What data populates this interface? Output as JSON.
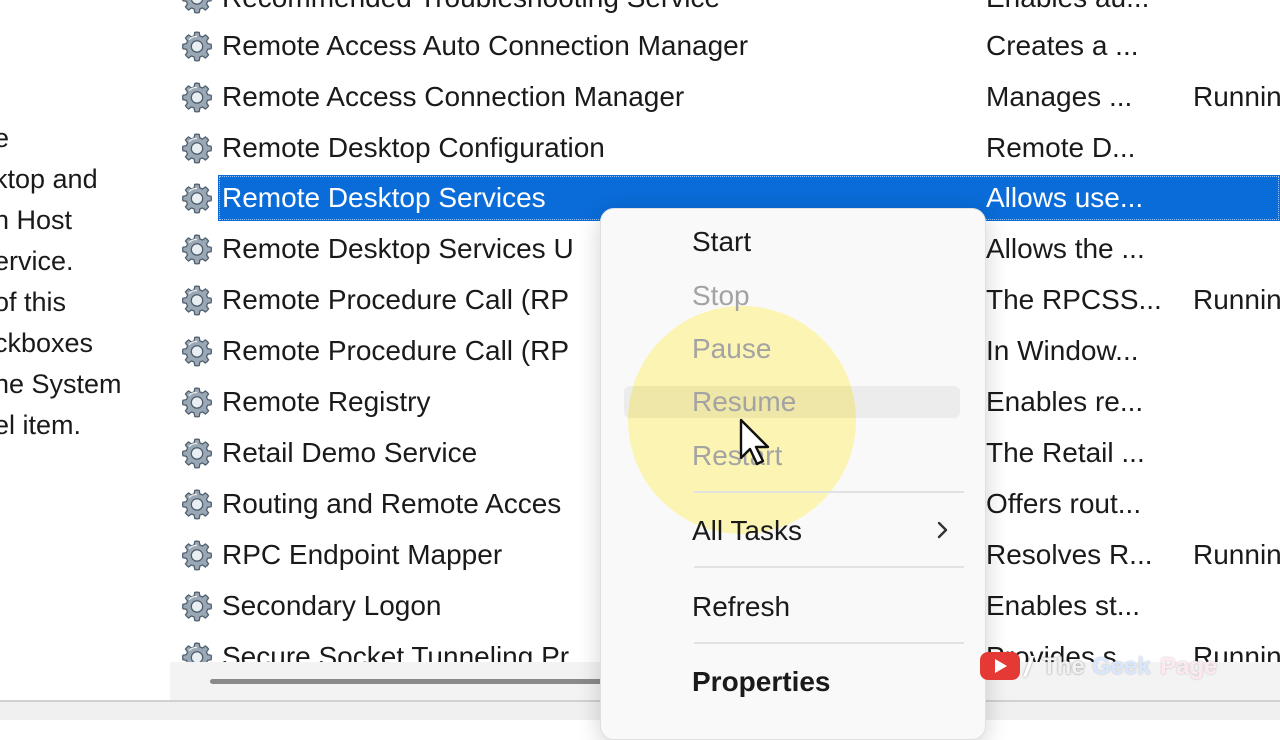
{
  "description_pane": {
    "lines": [
      "e",
      "ktop and",
      "n Host",
      "ervice.",
      "of this",
      "ckboxes",
      "ne System",
      "el item."
    ]
  },
  "services": [
    {
      "name": "Recommended Troubleshooting Service",
      "description": "Enables au...",
      "status": ""
    },
    {
      "name": "Remote Access Auto Connection Manager",
      "description": "Creates a ...",
      "status": ""
    },
    {
      "name": "Remote Access Connection Manager",
      "description": "Manages ...",
      "status": "Runnin"
    },
    {
      "name": "Remote Desktop Configuration",
      "description": "Remote D...",
      "status": ""
    },
    {
      "name": "Remote Desktop Services",
      "description": "Allows use...",
      "status": "",
      "selected": true
    },
    {
      "name": "Remote Desktop Services U",
      "description": "Allows the ...",
      "status": ""
    },
    {
      "name": "Remote Procedure Call (RP",
      "description": "The RPCSS...",
      "status": "Runnin"
    },
    {
      "name": "Remote Procedure Call (RP",
      "description": "In Window...",
      "status": ""
    },
    {
      "name": "Remote Registry",
      "description": "Enables re...",
      "status": ""
    },
    {
      "name": "Retail Demo Service",
      "description": "The Retail ...",
      "status": ""
    },
    {
      "name": "Routing and Remote Acces",
      "description": "Offers rout...",
      "status": ""
    },
    {
      "name": "RPC Endpoint Mapper",
      "description": "Resolves R...",
      "status": "Runnin"
    },
    {
      "name": "Secondary Logon",
      "description": "Enables st...",
      "status": ""
    },
    {
      "name": "Secure Socket Tunneling Pr",
      "description": "Provides s...",
      "status": "Runnin"
    }
  ],
  "context_menu": {
    "start": "Start",
    "stop": "Stop",
    "pause": "Pause",
    "resume": "Resume",
    "restart": "Restart",
    "all_tasks": "All Tasks",
    "refresh": "Refresh",
    "properties": "Properties"
  },
  "watermark": {
    "slash": "/",
    "the": "The",
    "geek": "Geek",
    "page": "Page"
  },
  "icons": {
    "service": "gear-icon",
    "submenu": "chevron-right-icon",
    "pointer": "mouse-pointer-icon",
    "video": "youtube-play-icon"
  },
  "colors": {
    "selection": "#0a6cd8",
    "disabled_text": "#a3a3a3",
    "highlight": "#fff078"
  }
}
